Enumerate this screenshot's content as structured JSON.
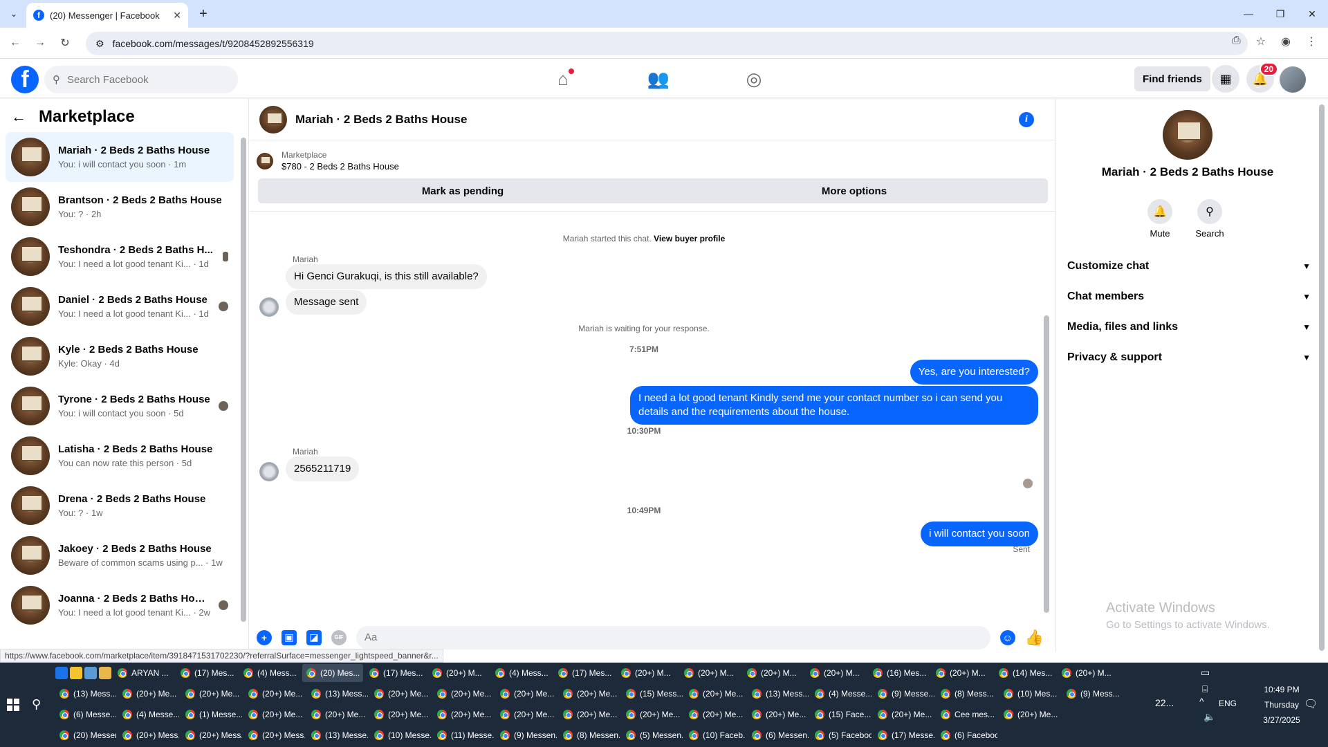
{
  "browser": {
    "tab_title": "(20) Messenger | Facebook",
    "url": "facebook.com/messages/t/9208452892556319",
    "status_url": "https://www.facebook.com/marketplace/item/3918471531702230/?referralSurface=messenger_lightspeed_banner&r..."
  },
  "header": {
    "search_placeholder": "Search Facebook",
    "find_friends": "Find friends",
    "notification_count": "20"
  },
  "left_panel": {
    "title": "Marketplace",
    "conversations": [
      {
        "name": "Mariah · 2 Beds 2 Baths House",
        "preview": "You: i will contact you soon · 1m"
      },
      {
        "name": "Brantson · 2 Beds 2 Baths House",
        "preview": "You: ? · 2h"
      },
      {
        "name": "Teshondra · 2 Beds 2 Baths H...",
        "preview": "You: I need a lot good tenant Ki... · 1d"
      },
      {
        "name": "Daniel · 2 Beds 2 Baths House",
        "preview": "You: I need a lot good tenant Ki... · 1d"
      },
      {
        "name": "Kyle · 2 Beds 2 Baths House",
        "preview": "Kyle: Okay · 4d"
      },
      {
        "name": "Tyrone · 2 Beds 2 Baths House",
        "preview": "You: i will contact you soon · 5d"
      },
      {
        "name": "Latisha · 2 Beds 2 Baths House",
        "preview": "You can now rate this person · 5d"
      },
      {
        "name": "Drena · 2 Beds 2 Baths House",
        "preview": "You: ? · 1w"
      },
      {
        "name": "Jakoey · 2 Beds 2 Baths House",
        "preview": "Beware of common scams using p... · 1w"
      },
      {
        "name": "Joanna · 2 Beds 2 Baths House",
        "preview": "You: I need a lot good tenant Ki... · 2w"
      }
    ]
  },
  "chat": {
    "title": "Mariah · 2 Beds 2 Baths House",
    "marketplace_label": "Marketplace",
    "listing": "$780 - 2 Beds 2 Baths House",
    "mark_pending": "Mark as pending",
    "more_options": "More options",
    "started_text": "Mariah started this chat.",
    "view_profile": "View buyer profile",
    "sender_name": "Mariah",
    "msg1": "Hi Genci Gurakuqi, is this still available?",
    "msg2": "Message sent",
    "waiting": "Mariah is waiting for your response.",
    "time1": "7:51PM",
    "out1": "Yes, are you interested?",
    "out2": "I need a lot good tenant Kindly send me your contact number so i can send you details and the requirements about the house.",
    "time2": "10:30PM",
    "msg3": "2565211719",
    "time3": "10:49PM",
    "out3": "i will contact you soon",
    "sent": "Sent",
    "composer_placeholder": "Aa"
  },
  "right_panel": {
    "name": "Mariah · 2 Beds 2 Baths House",
    "mute": "Mute",
    "search": "Search",
    "sections": [
      "Customize chat",
      "Chat members",
      "Media, files and links",
      "Privacy & support"
    ],
    "activate_title": "Activate Windows",
    "activate_sub": "Go to Settings to activate Windows."
  },
  "taskbar": {
    "rows": [
      [
        "ARYAN ...",
        "(17) Mes...",
        "(4) Mess...",
        "(20) Mes...",
        "(17) Mes...",
        "(20+) M...",
        "(4) Mess...",
        "(17) Mes...",
        "(20+) M...",
        "(20+) M...",
        "(20+) M...",
        "(20+) M...",
        "(16) Mes...",
        "(20+) M...",
        "(14) Mes...",
        "(20+) M..."
      ],
      [
        "(13) Mess...",
        "(20+) Me...",
        "(20+) Me...",
        "(20+) Me...",
        "(13) Mess...",
        "(20+) Me...",
        "(20+) Me...",
        "(20+) Me...",
        "(20+) Me...",
        "(15) Mess...",
        "(20+) Me...",
        "(13) Mess...",
        "(4) Messe...",
        "(9) Messe...",
        "(8) Mess...",
        "(10) Mes...",
        "(9) Mess..."
      ],
      [
        "(6) Messe...",
        "(4) Messe...",
        "(1) Messe...",
        "(20+) Me...",
        "(20+) Me...",
        "(20+) Me...",
        "(20+) Me...",
        "(20+) Me...",
        "(20+) Me...",
        "(20+) Me...",
        "(20+) Me...",
        "(20+) Me...",
        "(15) Face...",
        "(20+) Me...",
        "Cee mes...",
        "(20+) Me..."
      ],
      [
        "(20) Messen...",
        "(20+) Mess...",
        "(20+) Mess...",
        "(20+) Mess...",
        "(13) Messe...",
        "(10) Messe...",
        "(11) Messe...",
        "(9) Messen...",
        "(8) Messen...",
        "(5) Messen...",
        "(10) Faceb...",
        "(6) Messen...",
        "(5) Faceboo...",
        "(17) Messe...",
        "(6) Faceboo..."
      ]
    ],
    "temperature": "22...",
    "language": "ENG",
    "time": "10:49 PM",
    "day": "Thursday",
    "date": "3/27/2025"
  }
}
